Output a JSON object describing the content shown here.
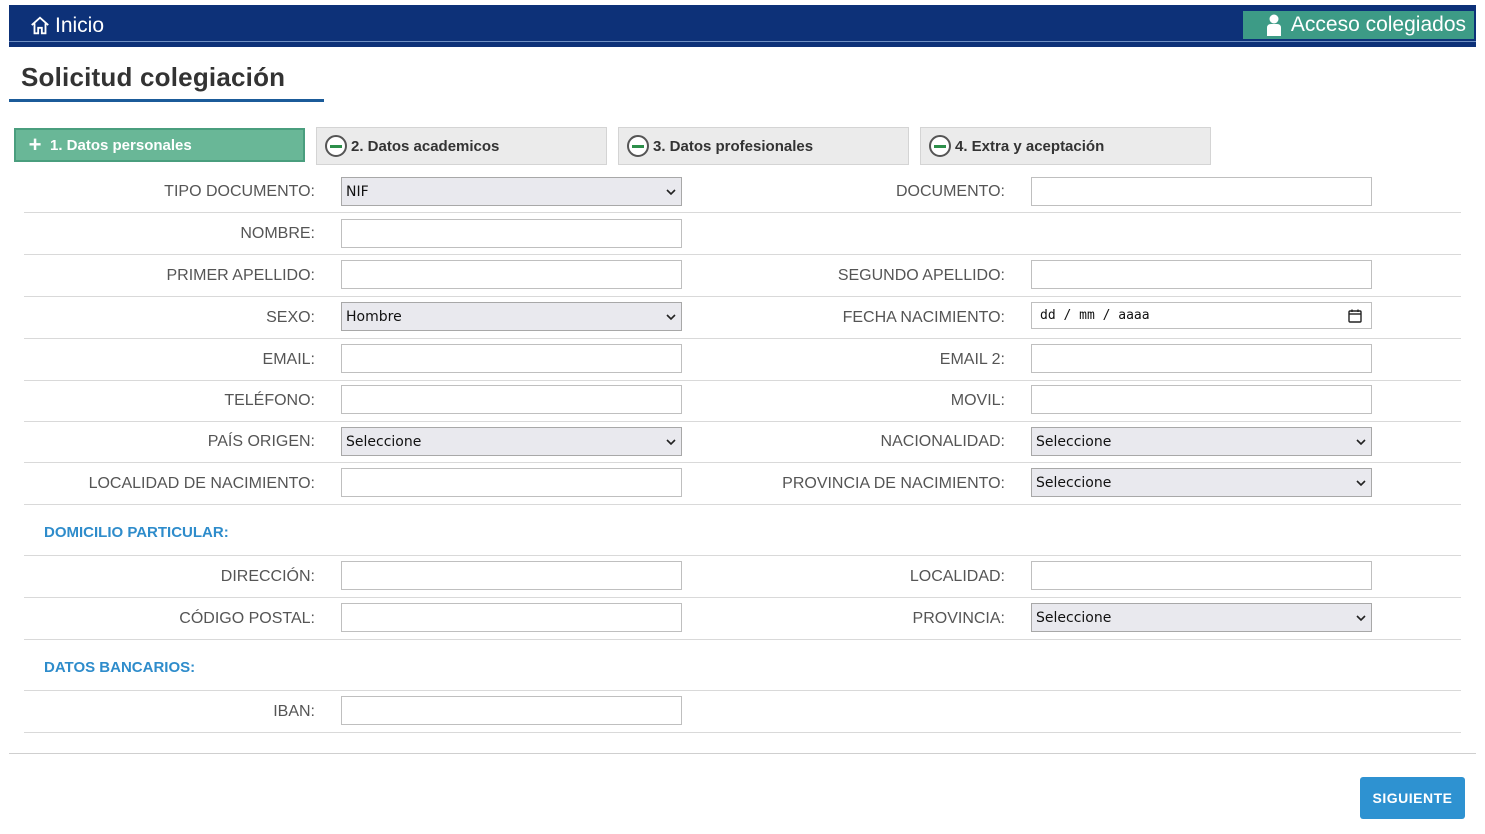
{
  "header": {
    "home_label": "Inicio",
    "access_label": "Acceso colegiados"
  },
  "page": {
    "title": "Solicitud colegiación"
  },
  "tabs": [
    {
      "label": "1. Datos personales",
      "active": true
    },
    {
      "label": "2. Datos academicos",
      "active": false
    },
    {
      "label": "3. Datos profesionales",
      "active": false
    },
    {
      "label": "4. Extra y aceptación",
      "active": false
    }
  ],
  "form": {
    "tipo_documento": {
      "label": "TIPO DOCUMENTO:",
      "value": "NIF"
    },
    "documento": {
      "label": "DOCUMENTO:",
      "value": ""
    },
    "nombre": {
      "label": "NOMBRE:",
      "value": ""
    },
    "primer_apellido": {
      "label": "PRIMER APELLIDO:",
      "value": ""
    },
    "segundo_apellido": {
      "label": "SEGUNDO APELLIDO:",
      "value": ""
    },
    "sexo": {
      "label": "SEXO:",
      "value": "Hombre"
    },
    "fecha_nacimiento": {
      "label": "FECHA NACIMIENTO:",
      "placeholder": "dd / mm / aaaa"
    },
    "email": {
      "label": "EMAIL:",
      "value": ""
    },
    "email2": {
      "label": "EMAIL 2:",
      "value": ""
    },
    "telefono": {
      "label": "TELÉFONO:",
      "value": ""
    },
    "movil": {
      "label": "MOVIL:",
      "value": ""
    },
    "pais_origen": {
      "label": "PAÍS ORIGEN:",
      "value": "Seleccione"
    },
    "nacionalidad": {
      "label": "NACIONALIDAD:",
      "value": "Seleccione"
    },
    "localidad_nacimiento": {
      "label": "LOCALIDAD DE NACIMIENTO:",
      "value": ""
    },
    "provincia_nacimiento": {
      "label": "PROVINCIA DE NACIMIENTO:",
      "value": "Seleccione"
    },
    "domicilio_title": "DOMICILIO PARTICULAR:",
    "direccion": {
      "label": "DIRECCIÓN:",
      "value": ""
    },
    "localidad": {
      "label": "LOCALIDAD:",
      "value": ""
    },
    "codigo_postal": {
      "label": "CÓDIGO POSTAL:",
      "value": ""
    },
    "provincia": {
      "label": "PROVINCIA:",
      "value": "Seleccione"
    },
    "bancarios_title": "DATOS BANCARIOS:",
    "iban": {
      "label": "IBAN:",
      "value": ""
    }
  },
  "actions": {
    "next_label": "SIGUIENTE"
  },
  "colors": {
    "header_bg": "#0d3178",
    "accent_green": "#3d9b86",
    "active_tab": "#69b797",
    "section_blue": "#2e8ccb",
    "button_blue": "#2e92d1"
  },
  "icons": {
    "home": "home-icon",
    "user": "user-icon",
    "chevron": "chevron-down-icon",
    "calendar": "calendar-icon"
  }
}
